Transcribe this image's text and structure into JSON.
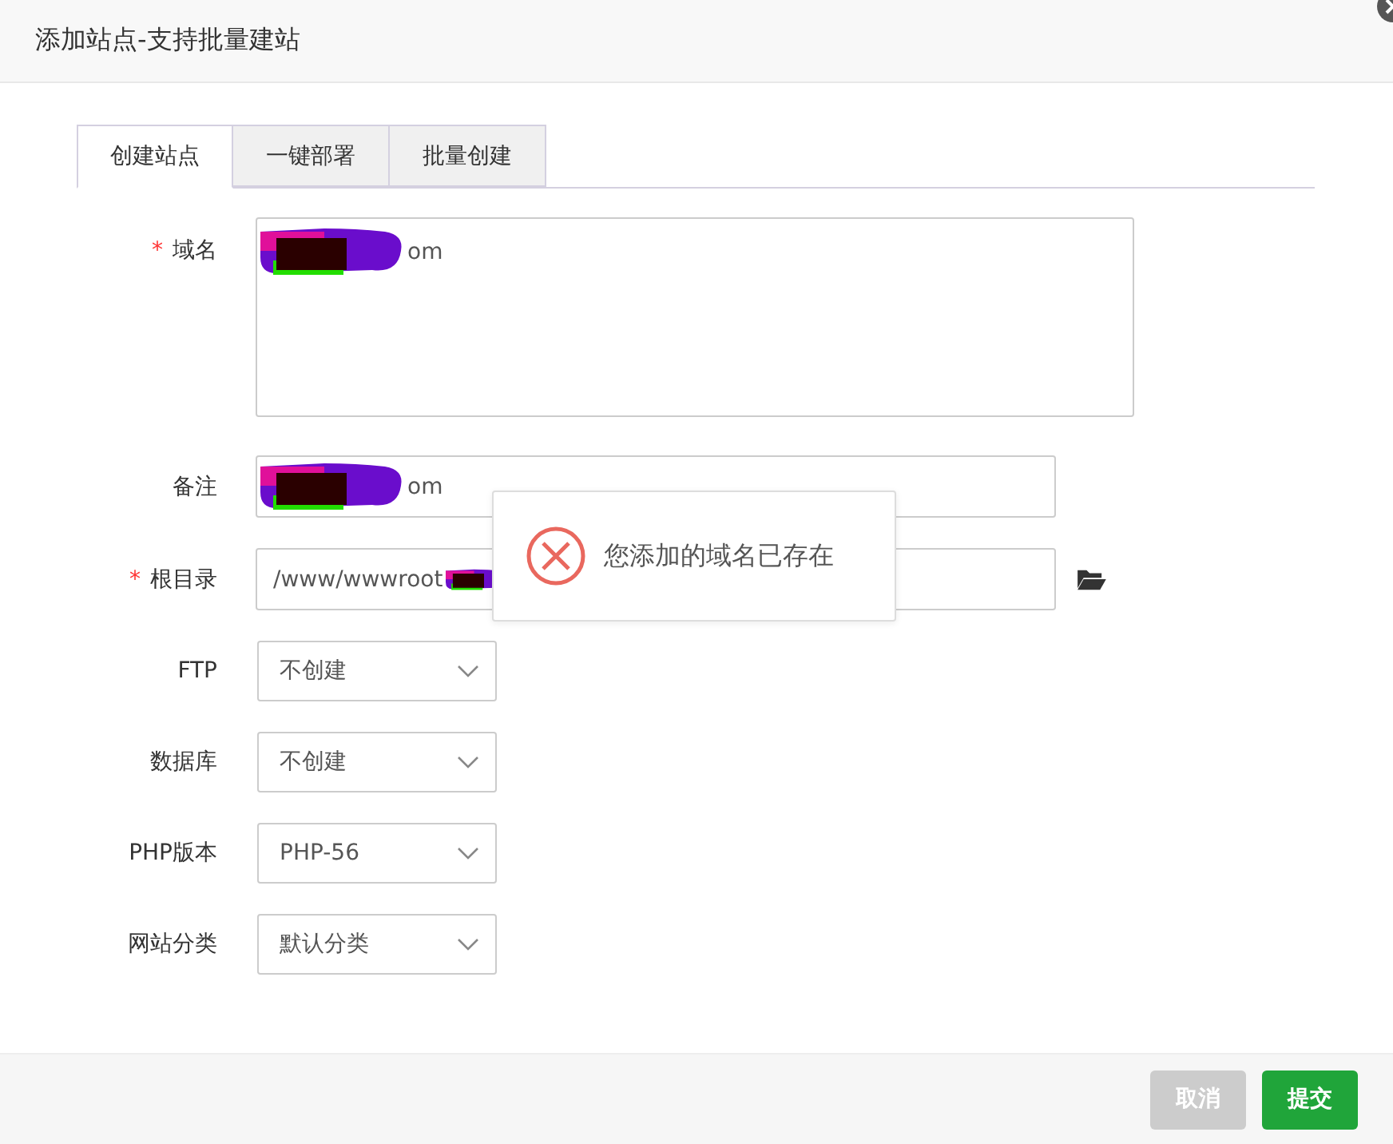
{
  "window": {
    "title": "添加站点-支持批量建站"
  },
  "tabs": [
    {
      "label": "创建站点",
      "selected": true
    },
    {
      "label": "一键部署",
      "selected": false
    },
    {
      "label": "批量创建",
      "selected": false
    }
  ],
  "fields": [
    {
      "kind": "textarea",
      "label": "域名",
      "required_mark": "*",
      "value": "om",
      "redacted": true
    },
    {
      "kind": "input",
      "label": "备注",
      "value": "om",
      "redacted": true
    },
    {
      "kind": "path",
      "label": "根目录",
      "required_mark": "*",
      "value": "/www/wwwroot",
      "redacted": true
    },
    {
      "kind": "select",
      "label": "FTP",
      "value": "不创建"
    },
    {
      "kind": "select",
      "label": "数据库",
      "value": "不创建"
    },
    {
      "kind": "select",
      "label": "PHP版本",
      "value": "PHP-56"
    },
    {
      "kind": "select",
      "label": "网站分类",
      "value": "默认分类"
    }
  ],
  "toast": {
    "message": "您添加的域名已存在"
  },
  "buttons": [
    {
      "label": "取消",
      "kind": "cancel"
    },
    {
      "label": "提交",
      "kind": "submit"
    }
  ]
}
